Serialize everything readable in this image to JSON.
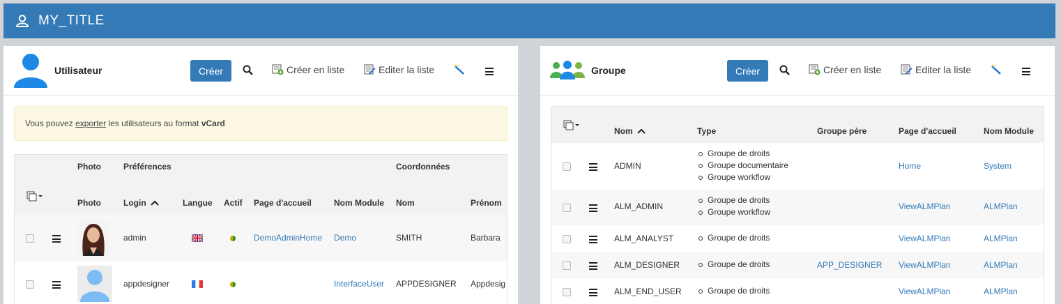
{
  "topbar": {
    "title": "MY_TITLE"
  },
  "left_panel": {
    "title": "Utilisateur",
    "create_label": "Créer",
    "create_list_label": "Créer en liste",
    "edit_list_label": "Editer la liste",
    "info": {
      "before": "Vous pouvez ",
      "link": "exporter",
      "middle": " les utilisateurs au format ",
      "bold": "vCard"
    },
    "group_headers": {
      "photo": "Photo",
      "preferences": "Préférences",
      "coordonnees": "Coordonnées"
    },
    "columns": [
      "Photo",
      "Login",
      "Langue",
      "Actif",
      "Page d'accueil",
      "Nom Module",
      "Nom",
      "Prénom"
    ],
    "rows": [
      {
        "login": "admin",
        "langue": "en-flag",
        "page": "DemoAdminHome",
        "module": "Demo",
        "nom": "SMITH",
        "prenom": "Barbara"
      },
      {
        "login": "appdesigner",
        "langue": "fr-flag",
        "page": "",
        "module": "InterfaceUser",
        "nom": "APPDESIGNER",
        "prenom": "Appdesig"
      }
    ]
  },
  "right_panel": {
    "title": "Groupe",
    "create_label": "Créer",
    "create_list_label": "Créer en liste",
    "edit_list_label": "Editer la liste",
    "columns": [
      "Nom",
      "Type",
      "Groupe père",
      "Page d'accueil",
      "Nom Module"
    ],
    "rows": [
      {
        "nom": "ADMIN",
        "types": [
          "Groupe de droits",
          "Groupe documentaire",
          "Groupe workflow"
        ],
        "pere": "",
        "page": "Home",
        "module": "System"
      },
      {
        "nom": "ALM_ADMIN",
        "types": [
          "Groupe de droits",
          "Groupe workflow"
        ],
        "pere": "",
        "page": "ViewALMPlan",
        "module": "ALMPlan"
      },
      {
        "nom": "ALM_ANALYST",
        "types": [
          "Groupe de droits"
        ],
        "pere": "",
        "page": "ViewALMPlan",
        "module": "ALMPlan"
      },
      {
        "nom": "ALM_DESIGNER",
        "types": [
          "Groupe de droits"
        ],
        "pere": "APP_DESIGNER",
        "page": "ViewALMPlan",
        "module": "ALMPlan"
      },
      {
        "nom": "ALM_END_USER",
        "types": [
          "Groupe de droits"
        ],
        "pere": "",
        "page": "ViewALMPlan",
        "module": "ALMPlan"
      }
    ]
  },
  "colors": {
    "primary": "#337ab7",
    "info_bg": "#fcf8e3",
    "link": "#337ab7"
  }
}
